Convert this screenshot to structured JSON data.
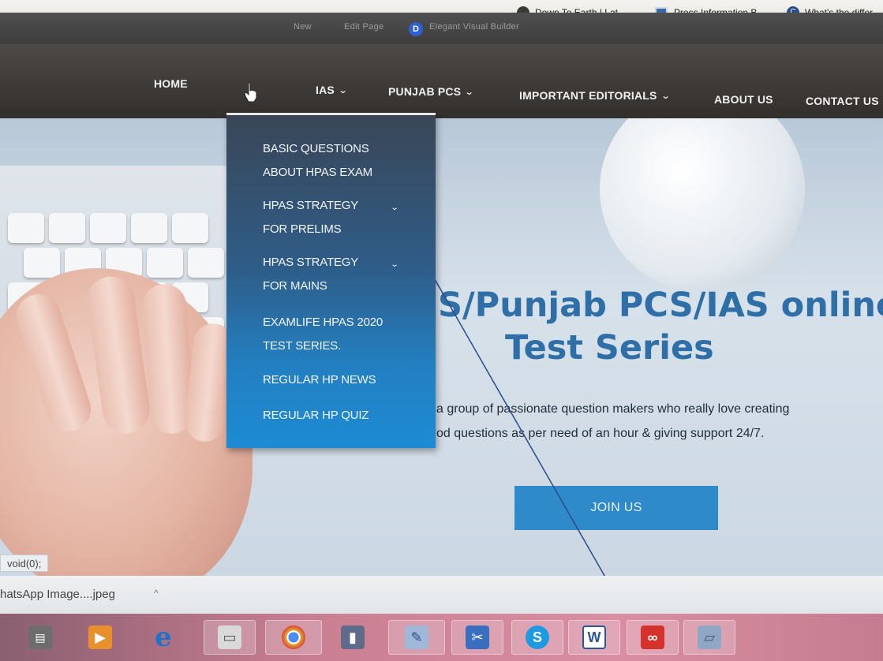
{
  "bookmarks": [
    {
      "label": "Down To Earth | Lat...",
      "icon": "circle-icon",
      "color": "#3a3a3a"
    },
    {
      "label": "Press Information B...",
      "icon": "pib-icon",
      "color": "#3b6aa8"
    },
    {
      "label": "What's the differ",
      "icon": "c-icon",
      "color": "#2b4a8a"
    }
  ],
  "adminbar": {
    "items": [
      "New",
      "Edit Page",
      "Elegant Visual Builder"
    ],
    "logo_letter": "D"
  },
  "nav": {
    "items": [
      {
        "label": "HOME",
        "has_dropdown": false
      },
      {
        "label": "IAS",
        "has_dropdown": true
      },
      {
        "label": "PUNJAB PCS",
        "has_dropdown": true
      },
      {
        "label": "IMPORTANT EDITORIALS",
        "has_dropdown": true
      },
      {
        "label": "ABOUT US",
        "has_dropdown": false
      },
      {
        "label": "CONTACT US",
        "has_dropdown": false
      }
    ],
    "chevron": "⌄"
  },
  "dropdown": {
    "items": [
      {
        "line1": "BASIC QUESTIONS",
        "line2": "ABOUT HPAS EXAM",
        "has_submenu": false
      },
      {
        "line1": "HPAS STRATEGY",
        "line2": "FOR PRELIMS",
        "has_submenu": true
      },
      {
        "line1": "HPAS STRATEGY",
        "line2": "FOR MAINS",
        "has_submenu": true
      },
      {
        "line1": "EXAMLIFE HPAS 2020",
        "line2": "TEST SERIES.",
        "has_submenu": false
      },
      {
        "line1": "REGULAR HP NEWS",
        "line2": "",
        "has_submenu": false
      },
      {
        "line1": "REGULAR HP QUIZ",
        "line2": "",
        "has_submenu": false
      }
    ]
  },
  "hero": {
    "title_line1": "S/Punjab PCS/IAS online",
    "title_line2": "Test Series",
    "desc_line1": "a group of passionate question makers who really love creating",
    "desc_line2": "od questions as per need of an hour & giving support 24/7.",
    "cta": "JOIN US",
    "title_color": "#2e6fa8",
    "cta_color": "#2e8ac8"
  },
  "status_text": "void(0);",
  "downloads": {
    "file": "hatsApp Image....jpeg",
    "caret": "^"
  },
  "taskbar": {
    "apps": [
      {
        "name": "file-manager-icon",
        "glyph": "▤"
      },
      {
        "name": "media-player-icon",
        "glyph": "▶"
      },
      {
        "name": "internet-explorer-icon",
        "glyph": "e"
      },
      {
        "name": "printer-icon",
        "glyph": "▭"
      },
      {
        "name": "chrome-icon",
        "glyph": "●"
      },
      {
        "name": "document-app-icon",
        "glyph": "▮"
      },
      {
        "name": "paint-icon",
        "glyph": "✎"
      },
      {
        "name": "snipping-tool-icon",
        "glyph": "✂"
      },
      {
        "name": "skype-icon",
        "glyph": "S"
      },
      {
        "name": "word-icon",
        "glyph": "W"
      },
      {
        "name": "adobe-cloud-icon",
        "glyph": "∞"
      },
      {
        "name": "notes-app-icon",
        "glyph": "▱"
      }
    ]
  }
}
